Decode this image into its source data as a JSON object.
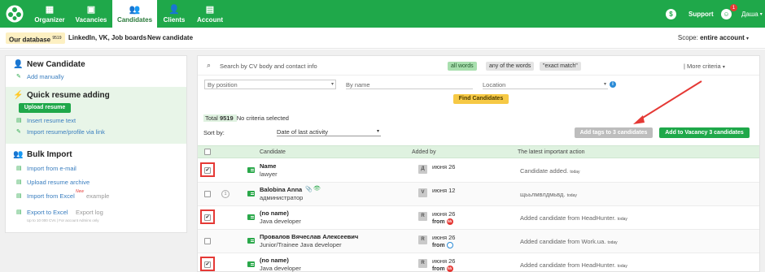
{
  "colors": {
    "brand": "#1fa84a",
    "accent_red": "#e53935",
    "link": "#3a7ebf",
    "yellow": "#f6c945"
  },
  "nav": {
    "items": [
      {
        "label": "Organizer",
        "icon": "organizer-icon"
      },
      {
        "label": "Vacancies",
        "icon": "briefcase-icon"
      },
      {
        "label": "Candidates",
        "icon": "people-icon"
      },
      {
        "label": "Clients",
        "icon": "client-icon"
      },
      {
        "label": "Account",
        "icon": "account-icon"
      }
    ],
    "active": "Candidates",
    "support": "Support",
    "notifications": "1",
    "user": "Даша"
  },
  "subnav": {
    "db_label": "Our database",
    "db_count": "9519",
    "tab2": "LinkedIn, VK, Job boards",
    "tab3": "New candidate",
    "scope_label": "Scope:",
    "scope_value": "entire account"
  },
  "sidebar": {
    "new_candidate": {
      "title": "New Candidate",
      "add_manually": "Add manually"
    },
    "quick_resume": {
      "title": "Quick resume adding",
      "upload_btn": "Upload resume",
      "insert_text": "Insert resume text",
      "import_link": "Import resume/profile via link"
    },
    "bulk": {
      "title": "Bulk Import",
      "from_email": "Import from e-mail",
      "upload_archive": "Upload resume archive",
      "from_excel": "Import from Excel",
      "new_badge": "New",
      "example": "example",
      "export_excel": "Export to Excel",
      "export_log": "Export log",
      "export_note": "Up to 10 000 CVs | For account Admins only"
    }
  },
  "search": {
    "placeholder": "Search by CV body and contact info",
    "modes": [
      "all words",
      "any of the words",
      "\"exact match\""
    ],
    "more_criteria": "| More criteria",
    "position_select": "By position",
    "name_placeholder": "By name",
    "location_placeholder": "Location",
    "find_btn": "Find Candidates"
  },
  "summary": {
    "total_label": "Total",
    "total_count": "9519",
    "criteria": "No criteria selected",
    "sort_label": "Sort by:",
    "sort_value": "Date of last activity",
    "add_tags_btn": "Add tags to 3 candidates",
    "add_vacancy_btn": "Add to Vacancy 3 candidates"
  },
  "table": {
    "headers": [
      "Candidate",
      "Added by",
      "The latest important action"
    ],
    "rows": [
      {
        "name": "Name",
        "position": "lawyer",
        "checked": true,
        "initial": "Д",
        "date": "июня 26",
        "from": "",
        "action": "Candidate added.",
        "when": "today"
      },
      {
        "name": "Balobina Anna",
        "position": "администратор",
        "checked": false,
        "initial": "V",
        "date": "июня 12",
        "from": "",
        "action": "щььлмвлдмьвд.",
        "when": "today"
      },
      {
        "name": "(no name)",
        "position": "Java developer",
        "checked": true,
        "initial": "R",
        "date": "июня 26",
        "from": "from",
        "source": "hh",
        "action": "Added candidate from HeadHunter.",
        "when": "today"
      },
      {
        "name": "Провалов Вячеслав Алексеевич",
        "position": "Junior/Trainee Java developer",
        "checked": false,
        "initial": "R",
        "date": "июня 26",
        "from": "from",
        "source": "wu",
        "action": "Added candidate from Work.ua.",
        "when": "today"
      },
      {
        "name": "(no name)",
        "position": "Java developer",
        "checked": true,
        "initial": "R",
        "date": "июня 26",
        "from": "from",
        "source": "hh",
        "action": "Added candidate from HeadHunter.",
        "when": "today"
      }
    ]
  }
}
